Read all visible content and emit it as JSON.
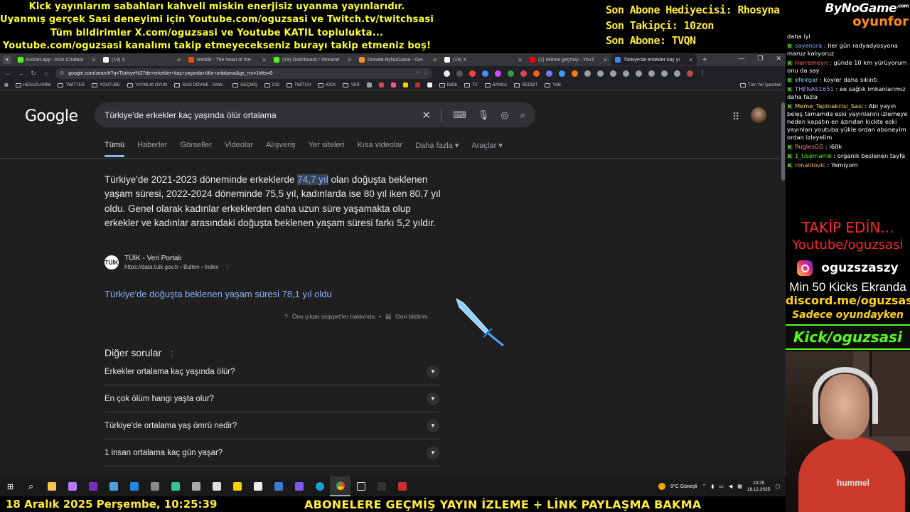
{
  "overlay": {
    "lines": [
      "Kick yayınlarım sabahları kahveli miskin enerjisiz uyanma yayınlarıdır.",
      "Uyanmış gerçek Sasi deneyimi için Youtube.com/oguzsasi ve Twitch.tv/twitchsasi",
      "Tüm bildirimler X.com/oguzsasi ve Youtube KATIL toplulukta...",
      "Youtube.com/oguzsasi kanalımı takip etmeyecekseniz burayı takip etmeniz boş!"
    ],
    "right": [
      "Son Abone Hediyecisi: Rhosyna",
      "Son Takipçi: 10zon",
      "Son Abone: TVQN"
    ],
    "brand_top": "ByNoGame",
    "brand_sup": ".com",
    "brand_bottom": "oyunfor"
  },
  "browser": {
    "tabs": [
      {
        "label": "Kicklet.app - Kick Chatbot",
        "color": "#53fc18"
      },
      {
        "label": "(19) X",
        "color": "#ffffff"
      },
      {
        "label": "Reddit - The heart of the",
        "color": "#ff4500"
      },
      {
        "label": "(19) Dashboard / Streamit",
        "color": "#53fc18"
      },
      {
        "label": "Donate ByNoGame - Gel",
        "color": "#ff8c1a"
      },
      {
        "label": "(19) X",
        "color": "#ffffff"
      },
      {
        "label": "(2) İzleme geçmişi - YouT",
        "color": "#ff0000"
      },
      {
        "label": "Türkiye'de erkekler kaç yı",
        "color": "#4285f4"
      }
    ],
    "url": "google.com/search?q=Türkiye%27de+erkekler+kaç+yaşında+ölür+ortalama&gs_ivs=1#tts=0",
    "bookmarks": [
      "HESAPLARIM",
      "TWITTER",
      "YOUTUBE",
      "YAYINLIK OYUN",
      "SASİ DÖVME - RAW...",
      "GEÇMİŞ",
      "DSİ",
      "TWITCH",
      "KICK",
      "YER",
      "IMDb",
      "TV",
      "BANKA",
      "REDDIT",
      "YAB"
    ],
    "bookmarks_other": "Tüm Yer İşaretleri"
  },
  "google": {
    "logo": "Google",
    "query": "Türkiye'de erkekler kaç yaşında ölür ortalama",
    "tabs": [
      "Tümü",
      "Haberler",
      "Görseller",
      "Videolar",
      "Alışveriş",
      "Yer siteleri",
      "Kısa videolar",
      "Daha fazla ▾",
      "Araçlar ▾"
    ],
    "snippet_pre": "Türkiye'de 2021-2023 döneminde erkeklerde ",
    "snippet_hl": "74,7 yıl",
    "snippet_post": " olan doğuşta beklenen yaşam süresi, 2022-2024 döneminde 75,5 yıl, kadınlarda ise 80 yıl iken 80,7 yıl oldu. Genel olarak kadınlar erkeklerden daha uzun süre yaşamakta olup erkekler ve kadınlar arasındaki doğuşta beklenen yaşam süresi farkı 5,2 yıldır.",
    "source_name": "TÜİK - Veri Portalı",
    "source_url": "https://data.tuik.gov.tr › Bulten › Index",
    "source_icon": "TÜİK",
    "result_link": "Türkiye'de doğuşta beklenen yaşam süresi 78,1 yıl oldu",
    "about_snippet": "Öne çıkan snippet'ler hakkında",
    "feedback": "Geri bildirim",
    "other_q_title": "Diğer sorular",
    "questions": [
      "Erkekler ortalama kaç yaşında ölür?",
      "En çok ölüm hangi yaşta olur?",
      "Türkiye'de ortalama yaş ömrü nedir?",
      "1 insan ortalama kaç gün yaşar?"
    ]
  },
  "taskbar": {
    "weather": "9°C  Güneşli",
    "time": "10:25",
    "date": "18.12.2025"
  },
  "bottom": {
    "left": "18 Aralık 2025 Perşembe, 10:25:39",
    "right": "ABONELERE GEÇMİŞ YAYIN İZLEME + LİNK PAYLAŞMA BAKMA"
  },
  "chat": [
    {
      "user": "",
      "text": "daha iyi",
      "color": "#ffffff",
      "badge": false
    },
    {
      "user": "sayenora",
      "text": " : her gün radyadyosyona maruz kalıyoruz",
      "color": "#7fb3ff",
      "badge": true
    },
    {
      "user": "Harremeyn",
      "text": " : günde 10 km yürüyorum onu da say",
      "color": "#ff6b6b",
      "badge": true
    },
    {
      "user": "efeirgar",
      "text": " : koyler daha sıkıntı",
      "color": "#7fd8ff",
      "badge": true
    },
    {
      "user": "THENAS1651",
      "text": " : ee sağlık imkanlarımız daha fazla",
      "color": "#b39bff",
      "badge": true
    },
    {
      "user": "Meme_Tapinakcisi_Sasi",
      "text": " : Abi yayın beleş tamamda eski yayınlarını izlemeye neden kapatın en azından kickte eski yayınları youtuba yükle ordan aboneyim ordan izleyelim",
      "color": "#ffd966",
      "badge": true
    },
    {
      "user": "RuglesGG",
      "text": " : i60k",
      "color": "#ff8c8c",
      "badge": true
    },
    {
      "user": "1_Username",
      "text": " : organik beslenen tayfa",
      "color": "#53fc18",
      "badge": true
    },
    {
      "user": "ronaldovic",
      "text": " : Yemiyom",
      "color": "#ffb366",
      "badge": true
    }
  ],
  "panel": {
    "follow": "TAKİP EDİN...",
    "youtube": "Youtube/oguzsasi",
    "instagram": "oguzszaszy",
    "min_kicks": "Min 50 Kicks Ekranda",
    "discord": "discord.me/oguzsasi",
    "only_game": "Sadece oyundayken",
    "kick": "Kick/oguzsasi"
  },
  "webcam": {
    "shirt_logo": "hummel"
  }
}
